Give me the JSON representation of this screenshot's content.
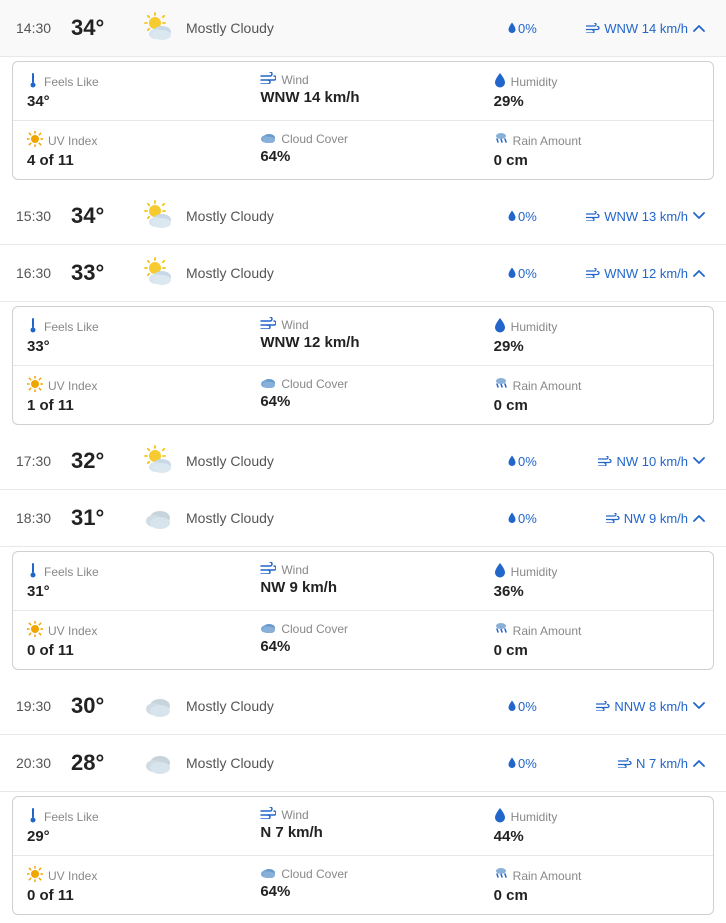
{
  "rows": [
    {
      "time": "14:30",
      "temp": "34°",
      "condition": "Mostly Cloudy",
      "iconType": "sun-cloud",
      "rain": "0%",
      "wind": "WNW 14 km/h",
      "chevron": "up",
      "expanded": true,
      "detail": {
        "feelsLike": "34°",
        "wind": "WNW 14 km/h",
        "humidity": "29%",
        "uvIndex": "4 of 11",
        "cloudCover": "64%",
        "rainAmount": "0 cm"
      }
    },
    {
      "time": "15:30",
      "temp": "34°",
      "condition": "Mostly Cloudy",
      "iconType": "sun-cloud",
      "rain": "0%",
      "wind": "WNW 13 km/h",
      "chevron": "down",
      "expanded": false
    },
    {
      "time": "16:30",
      "temp": "33°",
      "condition": "Mostly Cloudy",
      "iconType": "sun-cloud",
      "rain": "0%",
      "wind": "WNW 12 km/h",
      "chevron": "up",
      "expanded": true,
      "detail": {
        "feelsLike": "33°",
        "wind": "WNW 12 km/h",
        "humidity": "29%",
        "uvIndex": "1 of 11",
        "cloudCover": "64%",
        "rainAmount": "0 cm"
      }
    },
    {
      "time": "17:30",
      "temp": "32°",
      "condition": "Mostly Cloudy",
      "iconType": "sun-cloud",
      "rain": "0%",
      "wind": "NW 10 km/h",
      "chevron": "down",
      "expanded": false
    },
    {
      "time": "18:30",
      "temp": "31°",
      "condition": "Mostly Cloudy",
      "iconType": "cloud",
      "rain": "0%",
      "wind": "NW 9 km/h",
      "chevron": "up",
      "expanded": true,
      "detail": {
        "feelsLike": "31°",
        "wind": "NW 9 km/h",
        "humidity": "36%",
        "uvIndex": "0 of 11",
        "cloudCover": "64%",
        "rainAmount": "0 cm"
      }
    },
    {
      "time": "19:30",
      "temp": "30°",
      "condition": "Mostly Cloudy",
      "iconType": "cloud",
      "rain": "0%",
      "wind": "NNW 8 km/h",
      "chevron": "down",
      "expanded": false
    },
    {
      "time": "20:30",
      "temp": "28°",
      "condition": "Mostly Cloudy",
      "iconType": "cloud",
      "rain": "0%",
      "wind": "N 7 km/h",
      "chevron": "up",
      "expanded": true,
      "detail": {
        "feelsLike": "29°",
        "wind": "N 7 km/h",
        "humidity": "44%",
        "uvIndex": "0 of 11",
        "cloudCover": "64%",
        "rainAmount": "0 cm"
      }
    }
  ],
  "labels": {
    "feelsLike": "Feels Like",
    "wind": "Wind",
    "humidity": "Humidity",
    "uvIndex": "UV Index",
    "cloudCover": "Cloud Cover",
    "rainAmount": "Rain Amount"
  }
}
